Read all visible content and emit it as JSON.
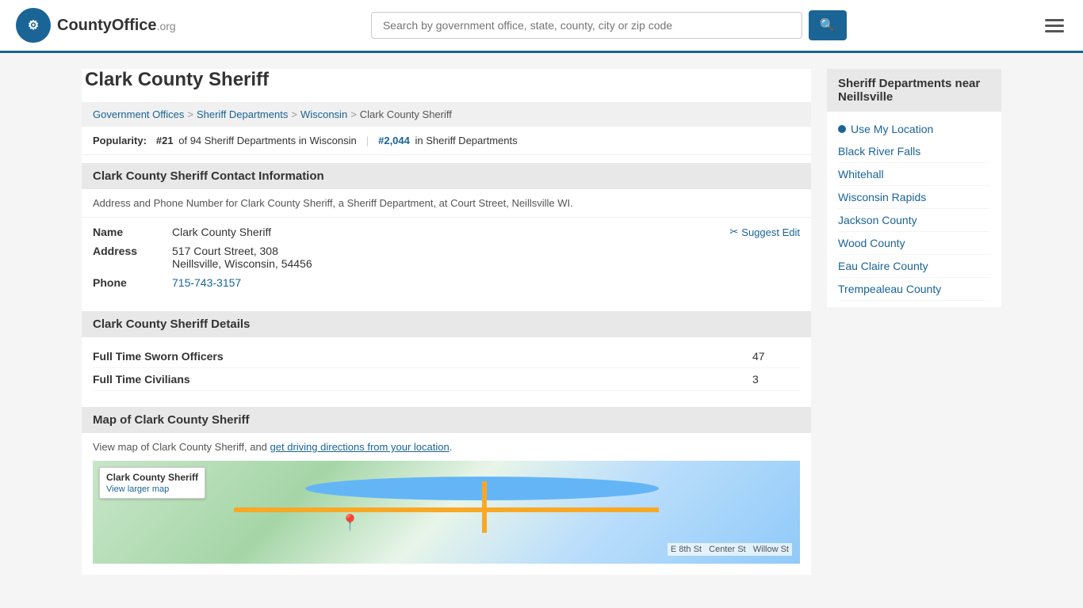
{
  "header": {
    "logo_text": "CountyOffice",
    "logo_org": ".org",
    "search_placeholder": "Search by government office, state, county, city or zip code",
    "search_icon": "🔍"
  },
  "page": {
    "title": "Clark County Sheriff",
    "breadcrumb": [
      {
        "label": "Government Offices",
        "href": "#"
      },
      {
        "label": "Sheriff Departments",
        "href": "#"
      },
      {
        "label": "Wisconsin",
        "href": "#"
      },
      {
        "label": "Clark County Sheriff",
        "href": "#"
      }
    ],
    "popularity_label": "Popularity:",
    "popularity_rank": "#21",
    "popularity_context": "of 94 Sheriff Departments in Wisconsin",
    "popularity_national": "#2,044",
    "popularity_national_context": "in Sheriff Departments"
  },
  "contact_section": {
    "title": "Clark County Sheriff Contact Information",
    "description": "Address and Phone Number for Clark County Sheriff, a Sheriff Department, at Court Street, Neillsville WI.",
    "name_label": "Name",
    "name_value": "Clark County Sheriff",
    "address_label": "Address",
    "address_line1": "517 Court Street, 308",
    "address_line2": "Neillsville, Wisconsin, 54456",
    "phone_label": "Phone",
    "phone_value": "715-743-3157",
    "suggest_edit_label": "Suggest Edit"
  },
  "details_section": {
    "title": "Clark County Sheriff Details",
    "rows": [
      {
        "label": "Full Time Sworn Officers",
        "value": "47"
      },
      {
        "label": "Full Time Civilians",
        "value": "3"
      }
    ]
  },
  "map_section": {
    "title": "Map of Clark County Sheriff",
    "description": "View map of Clark County Sheriff, and ",
    "map_link_text": "get driving directions from your location",
    "map_label_title": "Clark County Sheriff",
    "map_label_link": "View larger map"
  },
  "sidebar": {
    "title": "Sheriff Departments near Neillsville",
    "use_location_label": "Use My Location",
    "links": [
      {
        "label": "Black River Falls"
      },
      {
        "label": "Whitehall"
      },
      {
        "label": "Wisconsin Rapids"
      },
      {
        "label": "Jackson County"
      },
      {
        "label": "Wood County"
      },
      {
        "label": "Eau Claire County"
      },
      {
        "label": "Trempealeau County"
      }
    ]
  }
}
